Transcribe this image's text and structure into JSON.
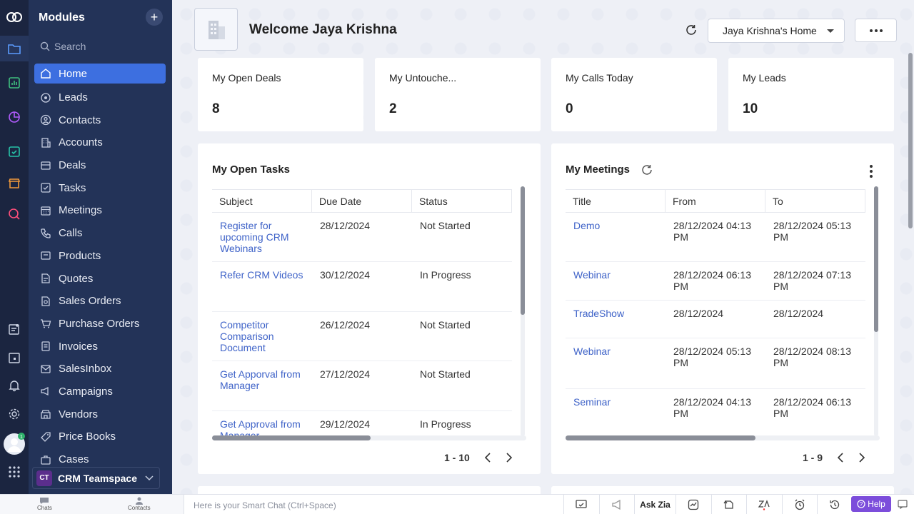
{
  "sidebar": {
    "title": "Modules",
    "search_placeholder": "Search",
    "items": [
      {
        "label": "Home",
        "icon": "home-icon"
      },
      {
        "label": "Leads",
        "icon": "leads-icon"
      },
      {
        "label": "Contacts",
        "icon": "contacts-icon"
      },
      {
        "label": "Accounts",
        "icon": "accounts-icon"
      },
      {
        "label": "Deals",
        "icon": "deals-icon"
      },
      {
        "label": "Tasks",
        "icon": "tasks-icon"
      },
      {
        "label": "Meetings",
        "icon": "meetings-icon"
      },
      {
        "label": "Calls",
        "icon": "calls-icon"
      },
      {
        "label": "Products",
        "icon": "products-icon"
      },
      {
        "label": "Quotes",
        "icon": "quotes-icon"
      },
      {
        "label": "Sales Orders",
        "icon": "sales-orders-icon"
      },
      {
        "label": "Purchase Orders",
        "icon": "purchase-orders-icon"
      },
      {
        "label": "Invoices",
        "icon": "invoices-icon"
      },
      {
        "label": "SalesInbox",
        "icon": "salesinbox-icon"
      },
      {
        "label": "Campaigns",
        "icon": "campaigns-icon"
      },
      {
        "label": "Vendors",
        "icon": "vendors-icon"
      },
      {
        "label": "Price Books",
        "icon": "price-books-icon"
      },
      {
        "label": "Cases",
        "icon": "cases-icon"
      }
    ],
    "team": {
      "badge": "CT",
      "label": "CRM Teamspace"
    }
  },
  "header": {
    "welcome": "Welcome Jaya Krishna",
    "home_select": "Jaya Krishna's Home"
  },
  "kpis": [
    {
      "title": "My Open Deals",
      "value": "8"
    },
    {
      "title": "My Untouche...",
      "value": "2"
    },
    {
      "title": "My Calls Today",
      "value": "0"
    },
    {
      "title": "My Leads",
      "value": "10"
    }
  ],
  "tasks": {
    "title": "My Open Tasks",
    "columns": [
      "Subject",
      "Due Date",
      "Status"
    ],
    "rows": [
      {
        "subject": "Register for upcoming CRM Webinars",
        "due": "28/12/2024",
        "status": "Not Started"
      },
      {
        "subject": "Refer CRM Videos",
        "due": "30/12/2024",
        "status": "In Progress"
      },
      {
        "subject": "Competitor Comparison Document",
        "due": "26/12/2024",
        "status": "Not Started"
      },
      {
        "subject": "Get Apporval from Manager",
        "due": "27/12/2024",
        "status": "Not Started"
      },
      {
        "subject": "Get Approval from Manager",
        "due": "29/12/2024",
        "status": "In Progress"
      }
    ],
    "pager": "1 - 10"
  },
  "meetings": {
    "title": "My Meetings",
    "columns": [
      "Title",
      "From",
      "To"
    ],
    "rows": [
      {
        "title": "Demo",
        "from": "28/12/2024 04:13 PM",
        "to": "28/12/2024 05:13 PM"
      },
      {
        "title": "Webinar",
        "from": "28/12/2024 06:13 PM",
        "to": "28/12/2024 07:13 PM"
      },
      {
        "title": "TradeShow",
        "from": "28/12/2024",
        "to": "28/12/2024"
      },
      {
        "title": "Webinar",
        "from": "28/12/2024 05:13 PM",
        "to": "28/12/2024 08:13 PM"
      },
      {
        "title": "Seminar",
        "from": "28/12/2024 04:13 PM",
        "to": "28/12/2024 06:13 PM"
      }
    ],
    "pager": "1 - 9"
  },
  "bottombar": {
    "chats": "Chats",
    "contacts": "Contacts",
    "smartchat": "Here is your Smart Chat (Ctrl+Space)",
    "ask_zia": "Ask Zia",
    "help": "Help"
  },
  "colors": {
    "rail": "#1b2540",
    "sidebar": "#233358",
    "active": "#3d6fe0",
    "link": "#3f63c8",
    "help": "#7c4ddb"
  }
}
